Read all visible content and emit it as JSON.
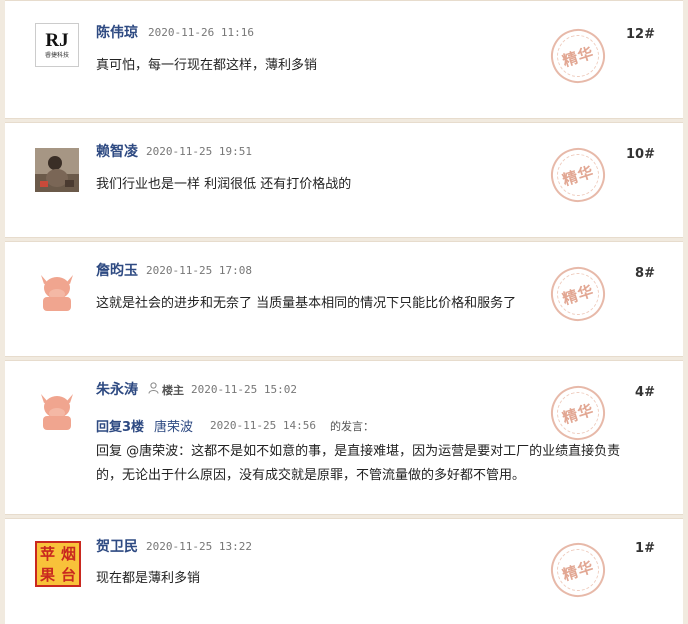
{
  "posts": [
    {
      "name": "陈伟琼",
      "time": "2020-11-26 11:16",
      "content": "真可怕，每一行现在都这样，薄利多销",
      "floor": "12#",
      "avatar_text": "RJ",
      "avatar_subtext": "睿捷科技",
      "stamp": "精华"
    },
    {
      "name": "赖智凌",
      "time": "2020-11-25 19:51",
      "content": "我们行业也是一样  利润很低  还有打价格战的",
      "floor": "10#",
      "stamp": "精华"
    },
    {
      "name": "詹昀玉",
      "time": "2020-11-25 17:08",
      "content": "这就是社会的进步和无奈了  当质量基本相同的情况下只能比价格和服务了",
      "floor": "8#",
      "stamp": "精华"
    },
    {
      "name": "朱永涛",
      "owner_label": "楼主",
      "time": "2020-11-25 15:02",
      "reply_floor": "回复3楼",
      "reply_user": "唐荣波",
      "reply_time": "2020-11-25 14:56",
      "reply_suffix": "的发言：",
      "content_line1": "回复 @唐荣波：这都不是如不如意的事，是直接难堪，因为运营是要对工厂的业绩直接负责",
      "content_line2": "的，无论出于什么原因，没有成交就是原罪，不管流量做的多好都不管用。",
      "floor": "4#",
      "stamp": "精华"
    },
    {
      "name": "贺卫民",
      "time": "2020-11-25 13:22",
      "content": "现在都是薄利多销",
      "floor": "1#",
      "avatar_chars": [
        "苹",
        "烟",
        "果",
        "台"
      ],
      "stamp": "精华"
    }
  ],
  "icons": {
    "owner_icon": "user-outline-icon",
    "cow_avatar": "cow-avatar-icon",
    "photo_avatar": "photo-avatar-icon"
  },
  "colors": {
    "username": "#2e4a82",
    "stamp": "#e2a793",
    "page_bg": "#f1eadf",
    "card_bg": "#ffffff",
    "cow": "#f0a58f",
    "fruit_bg": "#f8c23a",
    "fruit_text": "#c9281f"
  }
}
